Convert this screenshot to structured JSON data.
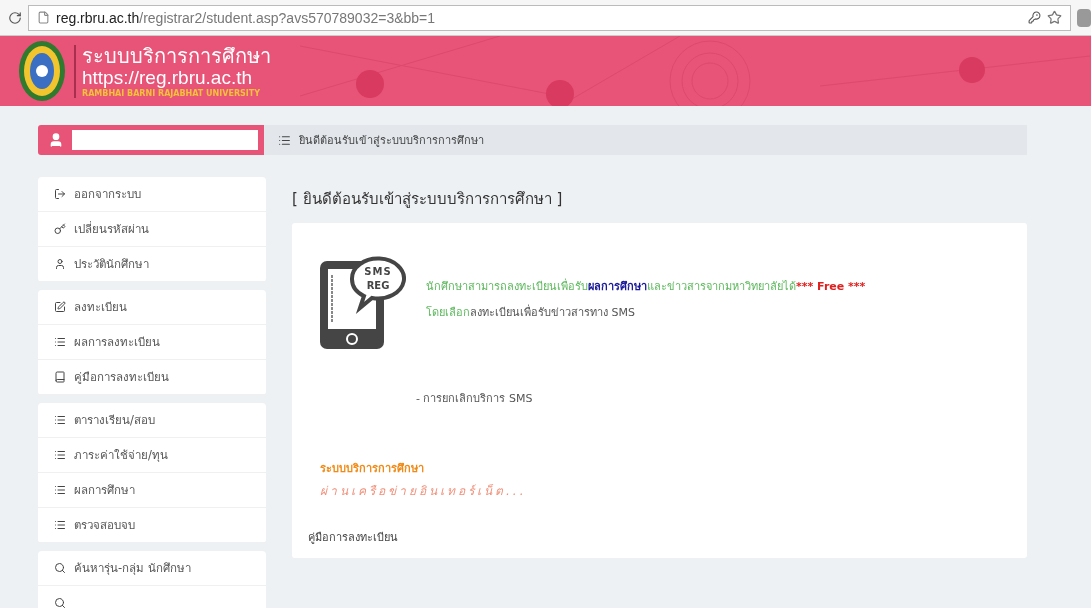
{
  "browser": {
    "url_host": "reg.rbru.ac.th",
    "url_path": "/registrar2/student.asp?avs570789032=3&bb=1"
  },
  "header": {
    "title": "ระบบบริการการศึกษา",
    "url": "https://reg.rbru.ac.th",
    "university": "RAMBHAI BARNI RAJABHAT UNIVERSITY"
  },
  "breadcrumb": {
    "text": "ยินดีต้อนรับเข้าสู่ระบบบริการการศึกษา"
  },
  "sidebar": {
    "groups": [
      {
        "items": [
          {
            "label": "ออกจากระบบ",
            "kind": "logout"
          },
          {
            "label": "เปลี่ยนรหัสผ่าน",
            "kind": "key"
          },
          {
            "label": "ประวัตินักศึกษา",
            "kind": "user"
          }
        ]
      },
      {
        "items": [
          {
            "label": "ลงทะเบียน",
            "kind": "edit"
          },
          {
            "label": "ผลการลงทะเบียน",
            "kind": "list"
          },
          {
            "label": "คู่มือการลงทะเบียน",
            "kind": "book"
          }
        ]
      },
      {
        "items": [
          {
            "label": "ตารางเรียน/สอบ",
            "kind": "list"
          },
          {
            "label": "ภาระค่าใช้จ่าย/ทุน",
            "kind": "list"
          },
          {
            "label": "ผลการศึกษา",
            "kind": "list"
          },
          {
            "label": "ตรวจสอบจบ",
            "kind": "list"
          }
        ]
      },
      {
        "items": [
          {
            "label": "ค้นหารุ่น-กลุ่ม นักศึกษา",
            "kind": "search"
          },
          {
            "kind": "search"
          }
        ]
      }
    ]
  },
  "main": {
    "title": "[ ยินดีต้อนรับเข้าสู่ระบบบริการการศึกษา ]",
    "sms_icon": {
      "top": "SMS",
      "bottom": "REG"
    },
    "sms_lines": [
      [
        {
          "text": "นักศึกษาสามารถลงทะเบียนเพื่อรับ",
          "kind": "green"
        },
        {
          "text": "ผลการศึกษา",
          "kind": "navy"
        },
        {
          "text": "และข่าวสารจากมหาวิทยาลัยได้",
          "kind": "green"
        },
        {
          "text": "*** Free ***",
          "kind": "red"
        }
      ],
      [
        {
          "text": "โดยเลือก",
          "kind": "green"
        },
        {
          "text": "ลงทะเบียนเพื่อรับข่าวสารทาง SMS",
          "kind": "gray"
        }
      ]
    ],
    "cancel_link": "- การยกเลิกบริการ SMS",
    "service_title": "ระบบบริการการศึกษา",
    "service_subtitle": "ผ่านเครือข่ายอินเทอร์เน็ต...",
    "manual_link": "คู่มือการลงทะเบียน"
  }
}
